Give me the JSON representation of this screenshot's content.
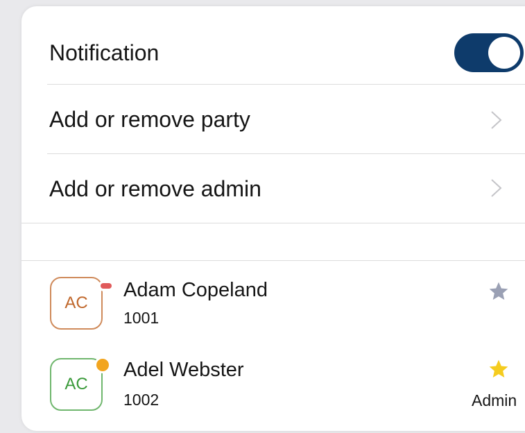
{
  "settings": {
    "notification_label": "Notification",
    "notification_enabled": true,
    "add_party_label": "Add or remove party",
    "add_admin_label": "Add or remove admin"
  },
  "members": [
    {
      "initials": "AC",
      "name": "Adam Copeland",
      "extension": "1001",
      "status": "busy",
      "starred": false,
      "role": ""
    },
    {
      "initials": "AC",
      "name": "Adel Webster",
      "extension": "1002",
      "status": "away",
      "starred": true,
      "role": "Admin"
    }
  ],
  "colors": {
    "toggle_on": "#0e3b6b",
    "star_active": "#f5cc1f",
    "star_inactive": "#9aa0b4",
    "status_busy": "#e05a5a",
    "status_away": "#f2a51f"
  }
}
